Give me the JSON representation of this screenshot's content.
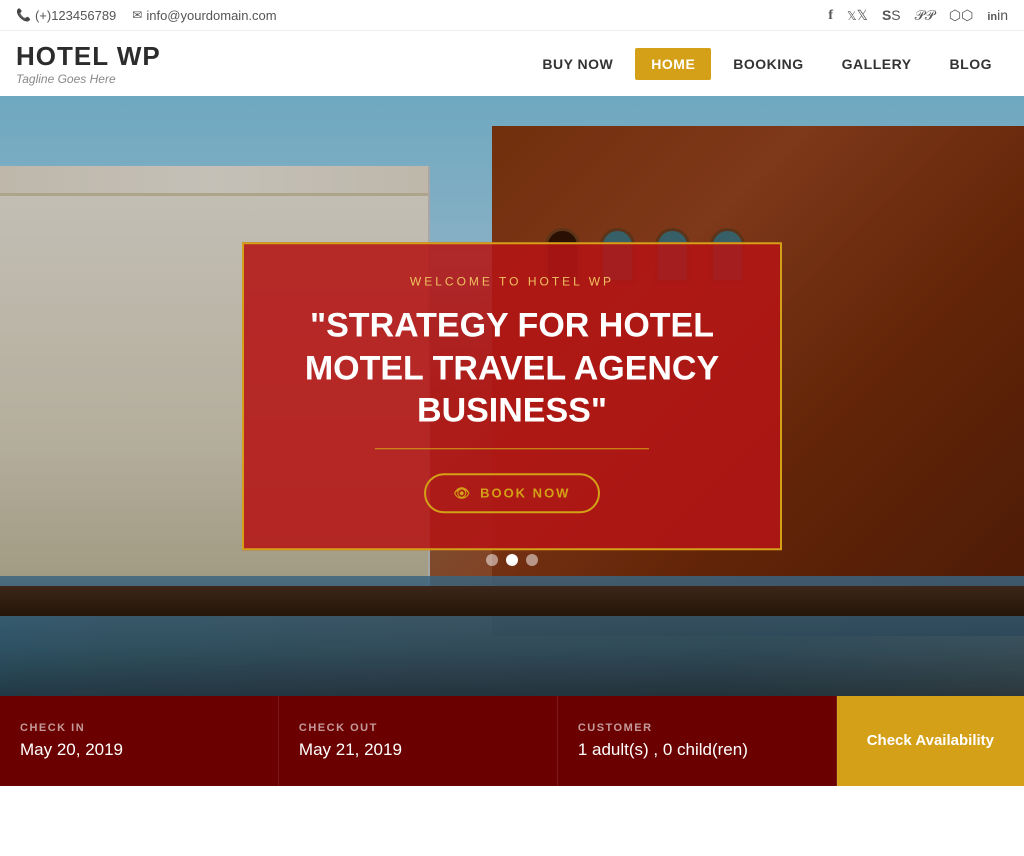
{
  "topbar": {
    "phone": "(+)123456789",
    "email": "info@yourdomain.com"
  },
  "header": {
    "logo_title": "HOTEL WP",
    "logo_tagline": "Tagline Goes Here",
    "nav": [
      {
        "label": "BUY NOW",
        "active": false
      },
      {
        "label": "HOME",
        "active": true
      },
      {
        "label": "BOOKING",
        "active": false
      },
      {
        "label": "GALLERY",
        "active": false
      },
      {
        "label": "BLOG",
        "active": false
      }
    ]
  },
  "hero": {
    "subtitle": "WELCOME TO HOTEL WP",
    "title": "\"STRATEGY FOR HOTEL MOTEL TRAVEL AGENCY BUSINESS\"",
    "book_now_label": "BOOK NOW"
  },
  "slider": {
    "dots": [
      {
        "active": false
      },
      {
        "active": true
      },
      {
        "active": false
      }
    ]
  },
  "booking_bar": {
    "checkin_label": "CHECK IN",
    "checkin_value": "May 20, 2019",
    "checkout_label": "CHECK OUT",
    "checkout_value": "May 21, 2019",
    "customer_label": "CUSTOMER",
    "customer_value": "1 adult(s) , 0 child(ren)",
    "cta_label": "Check Availability"
  },
  "social": {
    "facebook": "f",
    "twitter": "t",
    "skype": "S",
    "pinterest": "P",
    "instagram": "ig",
    "linkedin": "in"
  }
}
